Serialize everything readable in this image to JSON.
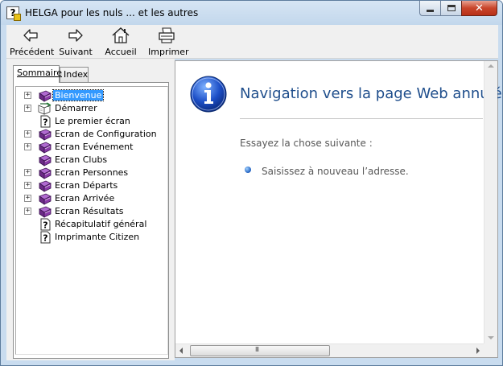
{
  "window": {
    "title": "HELGA pour les nuls ... et les autres",
    "close_glyph": "✕"
  },
  "toolbar": {
    "back": "Précédent",
    "forward": "Suivant",
    "home": "Accueil",
    "print": "Imprimer"
  },
  "tabs": {
    "contents": "Sommaire",
    "index": "Index"
  },
  "tree": {
    "items": [
      {
        "label": "Bienvenue",
        "icon": "book-icon",
        "expandable": true,
        "selected": true
      },
      {
        "label": "Démarrer",
        "icon": "book-open-icon",
        "expandable": true
      },
      {
        "label": "Le premier écran",
        "icon": "help-page-icon",
        "expandable": false
      },
      {
        "label": "Ecran de Configuration",
        "icon": "book-icon",
        "expandable": true
      },
      {
        "label": "Ecran Evénement",
        "icon": "book-icon",
        "expandable": true
      },
      {
        "label": "Ecran Clubs",
        "icon": "book-icon",
        "expandable": false
      },
      {
        "label": "Ecran Personnes",
        "icon": "book-icon",
        "expandable": true
      },
      {
        "label": "Ecran Départs",
        "icon": "book-icon",
        "expandable": true
      },
      {
        "label": "Ecran Arrivée",
        "icon": "book-icon",
        "expandable": true
      },
      {
        "label": "Ecran Résultats",
        "icon": "book-icon",
        "expandable": true
      },
      {
        "label": "Récapitulatif général",
        "icon": "help-page-icon",
        "expandable": false
      },
      {
        "label": "Imprimante Citizen",
        "icon": "help-page-icon",
        "expandable": false
      }
    ]
  },
  "content": {
    "title": "Navigation vers la page Web annulée",
    "suggestion_intro": "Essayez la chose suivante :",
    "suggestion": "Saisissez à nouveau l’adresse.",
    "title_color": "#1f4e8c"
  },
  "scrollbar": {
    "grip": "III"
  }
}
